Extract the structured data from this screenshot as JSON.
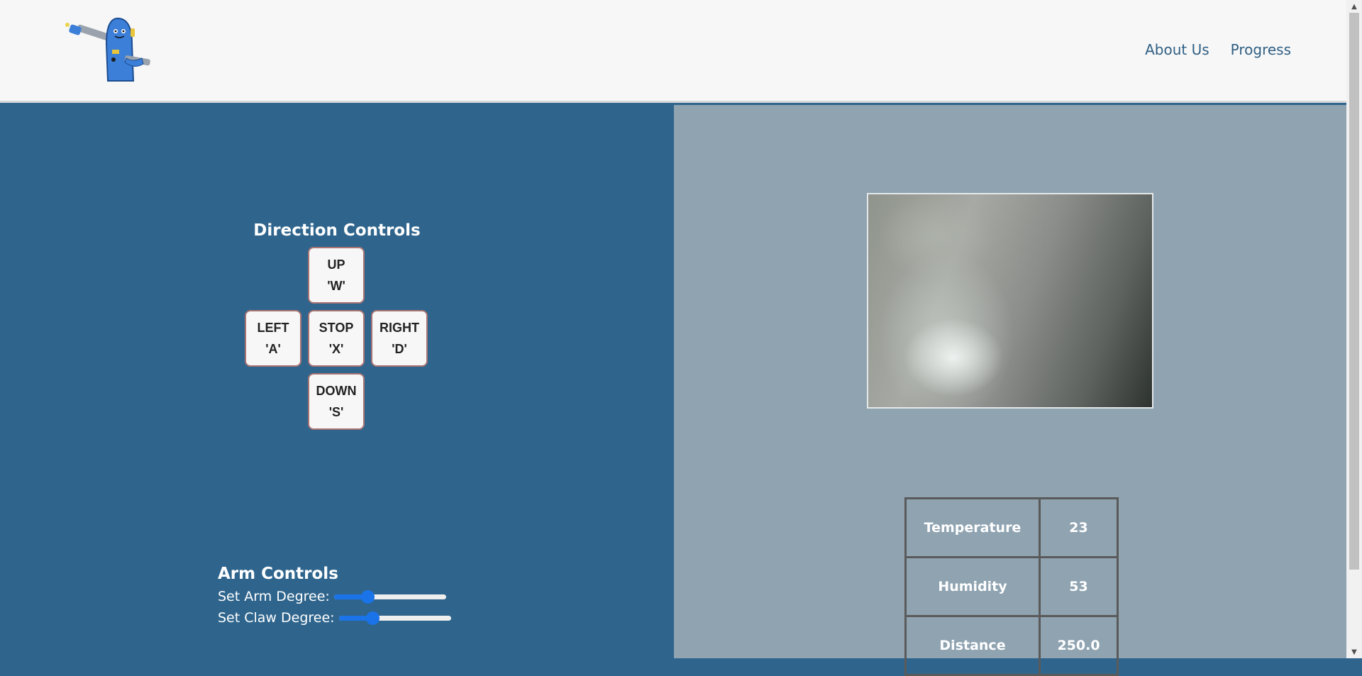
{
  "header": {
    "nav": {
      "about_us": "About Us",
      "progress": "Progress"
    }
  },
  "direction_controls": {
    "title": "Direction Controls",
    "buttons": {
      "up": {
        "label": "UP",
        "key": "'W'"
      },
      "left": {
        "label": "LEFT",
        "key": "'A'"
      },
      "stop": {
        "label": "STOP",
        "key": "'X'"
      },
      "right": {
        "label": "RIGHT",
        "key": "'D'"
      },
      "down": {
        "label": "DOWN",
        "key": "'S'"
      }
    }
  },
  "arm_controls": {
    "title": "Arm Controls",
    "arm_slider": {
      "label": "Set Arm Degree:",
      "value_fraction": 0.3
    },
    "claw_slider": {
      "label": "Set Claw Degree:",
      "value_fraction": 0.3
    }
  },
  "sensors": {
    "rows": [
      {
        "label": "Temperature",
        "value": "23"
      },
      {
        "label": "Humidity",
        "value": "53"
      },
      {
        "label": "Distance",
        "value": "250.0"
      }
    ]
  },
  "colors": {
    "header_bg": "#f7f7f7",
    "left_panel_bg": "#2f658d",
    "right_panel_bg": "#8fa3b1",
    "nav_link": "#2f5f84",
    "slider_accent": "#1a73e8",
    "button_border": "#a77373"
  },
  "icons": {
    "logo": "robot-logo",
    "scroll_up": "triangle-up-icon",
    "scroll_down": "triangle-down-icon"
  }
}
